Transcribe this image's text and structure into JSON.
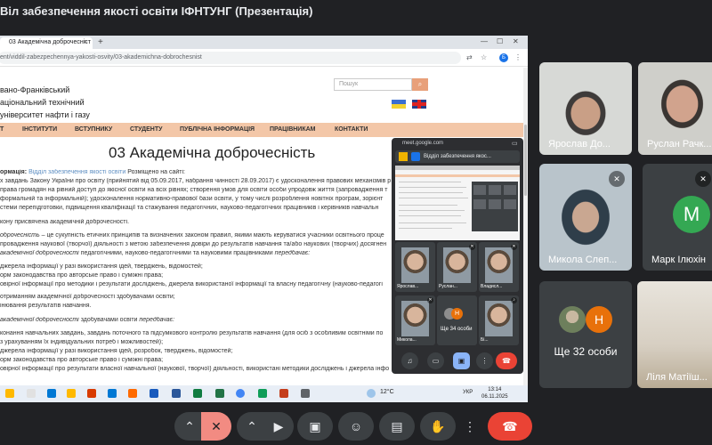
{
  "meeting": {
    "title": "Віл забезпечення якості освіти ІФНТУНГ (Презентація)"
  },
  "browser": {
    "tab_label": "03 Академічна доброчесніст",
    "tab_close": "×",
    "new_tab": "+",
    "url": "ent/viddil-zabezpechennya-yakosti-osvity/03-akademichna-dobrochesnist",
    "profile_letter": "Б"
  },
  "site": {
    "uni_line1": "вано-Франківський",
    "uni_line2": "аціональний технічний",
    "uni_line3": "університет нафти і газу",
    "search_placeholder": "Пошук",
    "nav": [
      "Т",
      "ІНСТИТУТИ",
      "ВСТУПНИКУ",
      "СТУДЕНТУ",
      "ПУБЛІЧНА ІНФОРМАЦІЯ",
      "ПРАЦІВНИКАМ",
      "КОНТАКТИ"
    ],
    "page_title": "03 Академічна доброчесність",
    "meta_prefix": "ормація:",
    "meta_link": "Відділ забезпечення якості освіти",
    "meta_suffix": "Розміщено на сайті:",
    "para1_l1": "х завдань Закону України про освіту (прийнятий від 05.09.2017, набрання чинності 28.09.2017) є удосконалення правових механізмів р",
    "para1_l2": "права громадян на рівний доступ до якісної освіти на всіх рівнях; створення умов для освіти особи упродовж життя (запровадження т",
    "para1_l3": "формальній та інформальній); удосконалення нормативно-правової бази освіти, у тому числі розроблення новітніх програм, зорієнт",
    "para1_l4": "стеми перепідготовки, підвищення кваліфікації та стажування педагогічних, науково-педагогічних працівників і керівників навчальн",
    "para2": "кону присвячена академічній доброчесності.",
    "def_l1_it": "оброчесність",
    "def_l1": " – це сукупність етичних принципів та визначених законом правил, якими мають керуватися учасники освітнього проце",
    "def_l2": "провадження наукової (творчої) діяльності з метою забезпечення довіри до результатів навчання та/або наукових (творчих) досягнен",
    "def_l3_it": "академічної доброчесності",
    "def_l3": " педагогічними, науково-педагогічними та науковими працівниками ",
    "def_l3_end": "передбачає:",
    "list1_1": "джерела інформації у разі використання ідей, тверджень, відомостей;",
    "list1_2": "орм законодавства про авторське право і суміжні права;",
    "list1_3": "овірної інформації про методики і результати досліджень, джерела використаної інформації та власну педагогічну (науково-педагогі",
    "list1_4": "отриманням академічної доброчесності здобувачами освіти;",
    "list1_5": "інювання результатів навчання.",
    "sec2_it": "академічної доброчесності",
    "sec2": " здобувачами освіти ",
    "sec2_end": "передбачає:",
    "list2_1": "конання навчальних завдань, завдань поточного та підсумкового контролю результатів навчання (для осіб з особливим освітніми по",
    "list2_2": "з урахуванням їх індивідуальних потреб і можливостей);",
    "list2_3": "джерела інформації у разі використання ідей, розробок, тверджень, відомостей;",
    "list2_4": "орм законодавства про авторське право і суміжні права;",
    "list2_5": "овірної інформації про результати власної навчальної (наукової, творчої) діяльності, використані методики досліджень і джерела інфо"
  },
  "popup": {
    "host": "meet.google.com",
    "tab_label": "Відділ забезпечення якос...",
    "tiles": [
      {
        "name": "Ярослав..."
      },
      {
        "name": "Руслан..."
      },
      {
        "name": "Владисл..."
      },
      {
        "name": "Микола..."
      },
      {
        "name": "Бі..."
      }
    ],
    "more_label": "Ще 34 особи",
    "more_letter": "Н"
  },
  "taskbar": {
    "temp": "12°C",
    "lang": "УКР",
    "time": "13:14",
    "date": "06.11.2025"
  },
  "participants": [
    {
      "name": "Ярослав До..."
    },
    {
      "name": "Руслан Рачк..."
    },
    {
      "name": "Микола Слеп..."
    },
    {
      "name": "Марк Ілюхін",
      "initial": "M"
    },
    {
      "name": "Ліля Матіїш..."
    }
  ],
  "more_participants": {
    "label": "Ще 32 особи",
    "letter": "Н"
  },
  "icons": {
    "mic_off": "mic-off-icon",
    "camera": "camera-icon",
    "present": "present-icon",
    "emoji": "emoji-icon",
    "captions": "captions-icon",
    "hand": "raise-hand-icon",
    "more": "more-options-icon",
    "hangup": "hang-up-icon"
  },
  "colors": {
    "meet_bg": "#202124",
    "tile_bg": "#3c4043",
    "hangup": "#ea4335",
    "mic_off": "#f28b82",
    "site_nav": "#f3c7a8",
    "link": "#5d8ec2",
    "avatar_m": "#34a853",
    "avatar_h": "#e8710a"
  }
}
